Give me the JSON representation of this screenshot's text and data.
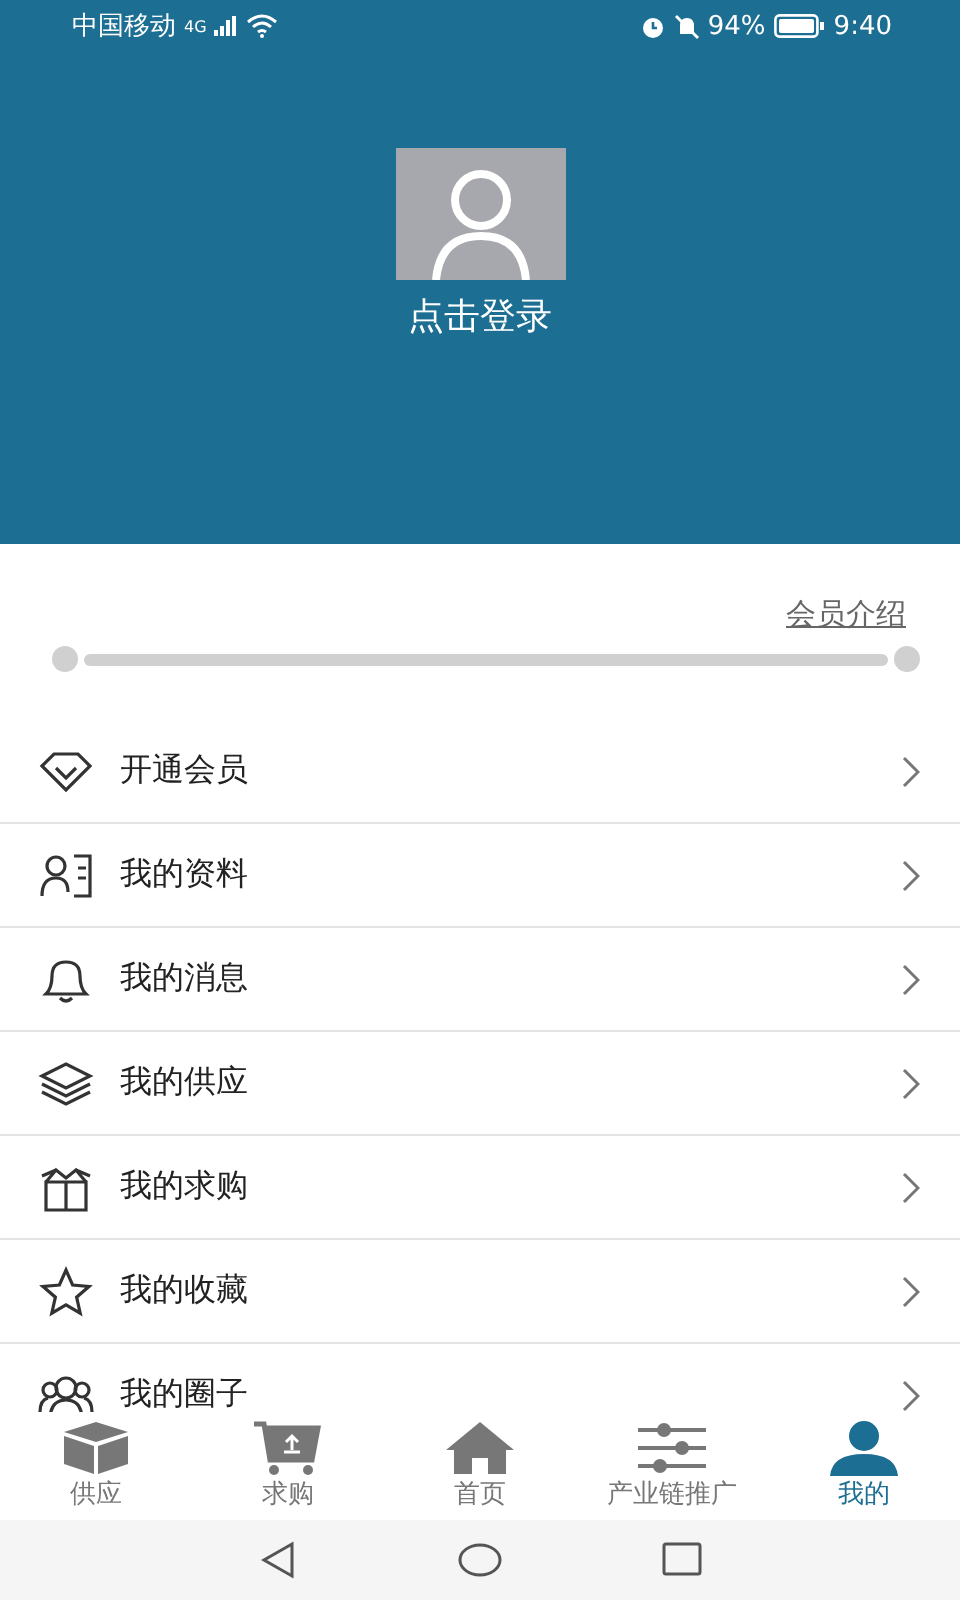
{
  "status_bar": {
    "carrier": "中国移动",
    "network": "4G",
    "battery": "94%",
    "time": "9:40"
  },
  "profile": {
    "login_label": "点击登录"
  },
  "membership": {
    "link": "会员介绍"
  },
  "menu": [
    {
      "kind": "diamond",
      "label": "开通会员"
    },
    {
      "kind": "profile",
      "label": "我的资料"
    },
    {
      "kind": "bell",
      "label": "我的消息"
    },
    {
      "kind": "layers",
      "label": "我的供应"
    },
    {
      "kind": "box",
      "label": "我的求购"
    },
    {
      "kind": "star",
      "label": "我的收藏"
    },
    {
      "kind": "group",
      "label": "我的圈子"
    }
  ],
  "tabs": [
    {
      "kind": "cube",
      "label": "供应",
      "selected": false
    },
    {
      "kind": "cart",
      "label": "求购",
      "selected": false
    },
    {
      "kind": "home",
      "label": "首页",
      "selected": false
    },
    {
      "kind": "sliders",
      "label": "产业链推广",
      "selected": false
    },
    {
      "kind": "person",
      "label": "我的",
      "selected": true
    }
  ]
}
